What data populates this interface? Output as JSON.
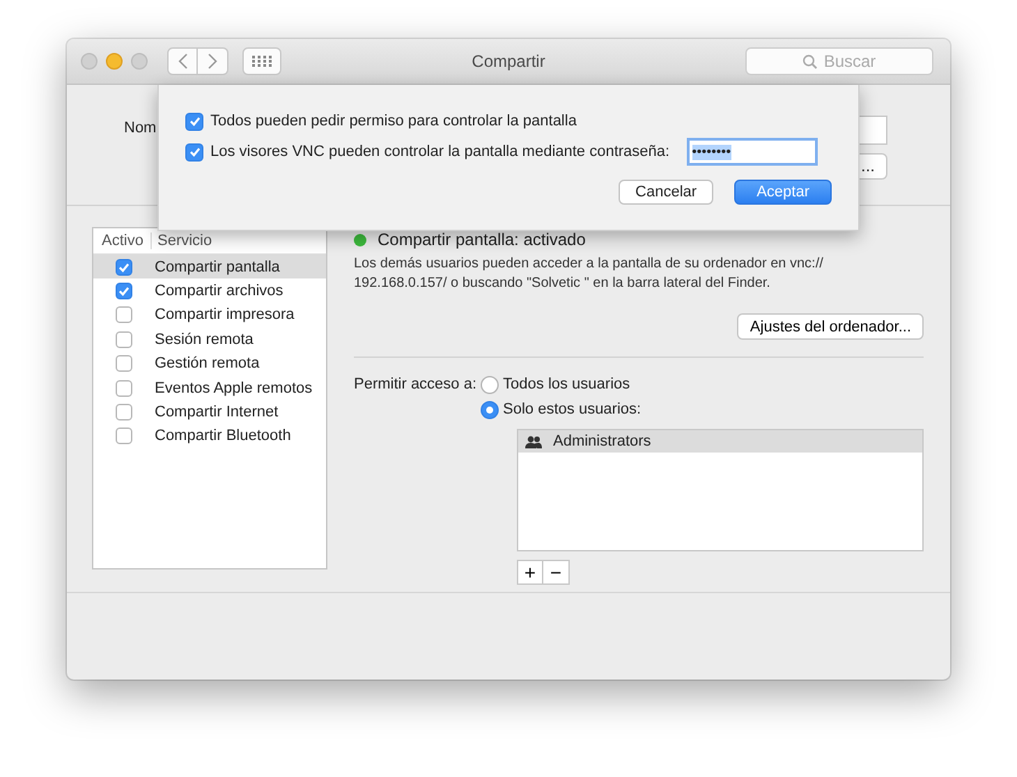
{
  "window": {
    "title": "Compartir"
  },
  "search": {
    "placeholder": "Buscar"
  },
  "computer_name": {
    "label": "Nom",
    "edit_button": "..."
  },
  "sheet": {
    "options": [
      {
        "label": "Todos pueden pedir permiso para controlar la pantalla",
        "checked": true
      },
      {
        "label": "Los visores VNC pueden controlar la pantalla mediante contraseña:",
        "checked": true
      }
    ],
    "password": {
      "value": "••••••••",
      "selected": true
    },
    "buttons": [
      {
        "label": "Cancelar",
        "primary": false
      },
      {
        "label": "Aceptar",
        "primary": true
      }
    ]
  },
  "services": {
    "columns": [
      "Activo",
      "Servicio"
    ],
    "items": [
      {
        "name": "Compartir pantalla",
        "checked": true,
        "selected": true
      },
      {
        "name": "Compartir archivos",
        "checked": true,
        "selected": false
      },
      {
        "name": "Compartir impresora",
        "checked": false,
        "selected": false
      },
      {
        "name": "Sesión remota",
        "checked": false,
        "selected": false
      },
      {
        "name": "Gestión remota",
        "checked": false,
        "selected": false
      },
      {
        "name": "Eventos Apple remotos",
        "checked": false,
        "selected": false
      },
      {
        "name": "Compartir Internet",
        "checked": false,
        "selected": false
      },
      {
        "name": "Compartir Bluetooth",
        "checked": false,
        "selected": false
      }
    ]
  },
  "status": {
    "text": "Compartir pantalla: activado",
    "on": true
  },
  "description": "Los demás usuarios pueden acceder a la pantalla de su ordenador en vnc:// 192.168.0.157/ o buscando \"Solvetic \" en la barra lateral del Finder.",
  "settings_button": "Ajustes del ordenador...",
  "access": {
    "label": "Permitir acceso a:",
    "options": [
      {
        "label": "Todos los usuarios",
        "selected": false
      },
      {
        "label": "Solo estos usuarios:",
        "selected": true
      }
    ],
    "users": [
      {
        "name": "Administrators",
        "selected": true
      }
    ],
    "add_button": "+",
    "remove_button": "−"
  }
}
